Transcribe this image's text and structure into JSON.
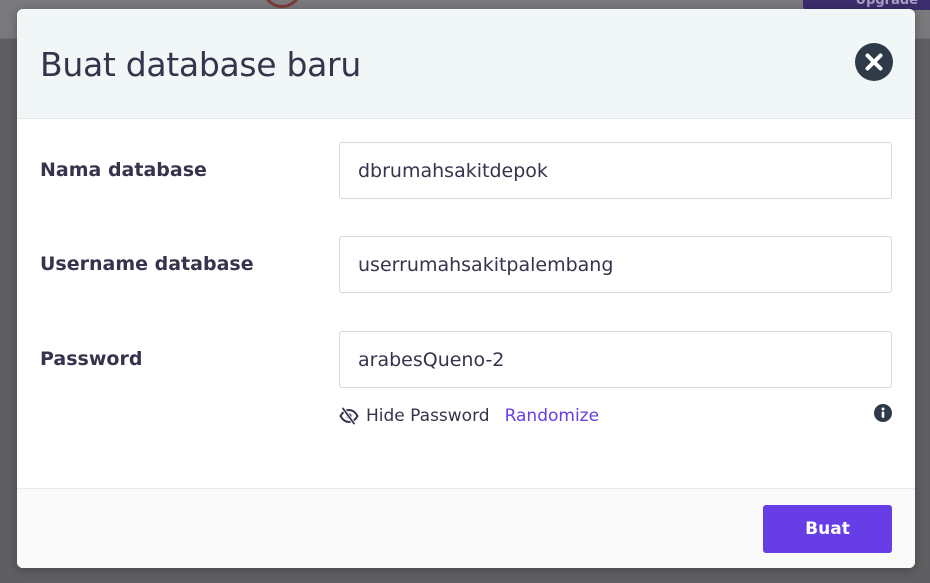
{
  "backdrop": {
    "upgrade_label": "Upgrade"
  },
  "modal": {
    "title": "Buat database baru",
    "fields": {
      "db_name": {
        "label": "Nama database",
        "value": "dbrumahsakitdepok"
      },
      "db_user": {
        "label": "Username database",
        "value": "userrumahsakitpalembang"
      },
      "password": {
        "label": "Password",
        "value": "arabesQueno-2"
      }
    },
    "hide_password_label": "Hide Password",
    "randomize_label": "Randomize",
    "submit_label": "Buat"
  },
  "colors": {
    "accent": "#673de6",
    "text": "#36344d",
    "header_bg": "#f1f7f7",
    "icon_dark": "#2f3a48"
  },
  "icons": [
    "close-icon",
    "eye-slash-icon",
    "info-icon"
  ]
}
